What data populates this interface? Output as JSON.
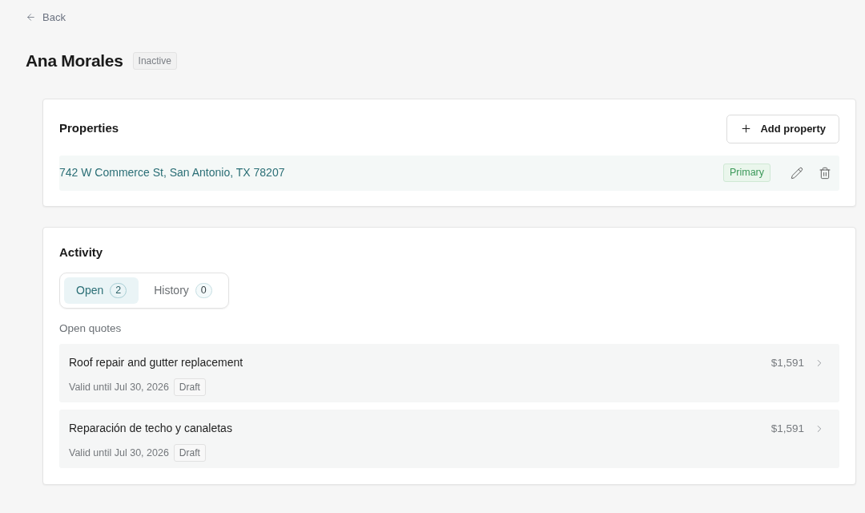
{
  "back_link": {
    "label": "Back"
  },
  "customer": {
    "name": "Ana Morales",
    "status": "Inactive"
  },
  "properties": {
    "title": "Properties",
    "add_button": "Add property",
    "items": [
      {
        "address": "742 W Commerce St, San Antonio, TX 78207",
        "badge": "Primary"
      }
    ]
  },
  "activity": {
    "title": "Activity",
    "tabs": [
      {
        "label": "Open",
        "count": "2",
        "selected": true
      },
      {
        "label": "History",
        "count": "0",
        "selected": false
      }
    ],
    "section_label": "Open quotes",
    "quotes": [
      {
        "title": "Roof repair and gutter replacement",
        "valid_until": "Valid until Jul 30, 2026",
        "status": "Draft",
        "amount": "$1,591"
      },
      {
        "title": "Reparación de techo y canaletas",
        "valid_until": "Valid until Jul 30, 2026",
        "status": "Draft",
        "amount": "$1,591"
      }
    ]
  }
}
